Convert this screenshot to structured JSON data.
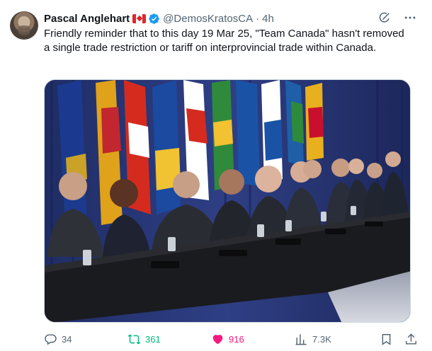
{
  "post": {
    "author_name": "Pascal Anglehart",
    "author_flag_icon": "canada-flag-icon",
    "verified_icon": "verified-badge-icon",
    "handle": "@DemosKratosCA",
    "separator": "·",
    "time": "4h",
    "text": "Friendly reminder that to this day 19 Mar 25, \"Team Canada\" hasn't removed a single trade restriction or tariff on interprovincial trade within Canada.",
    "media_icon": "photo-press-conference"
  },
  "top_icons": [
    "grok-icon",
    "more-icon"
  ],
  "actions": {
    "replies": "34",
    "reposts": "361",
    "likes": "916",
    "views": "7.3K"
  },
  "colors": {
    "repost_accent": "#00ba7c",
    "like_accent": "#f91880",
    "muted_text": "#536471",
    "verified_blue": "#1d9bf0"
  }
}
